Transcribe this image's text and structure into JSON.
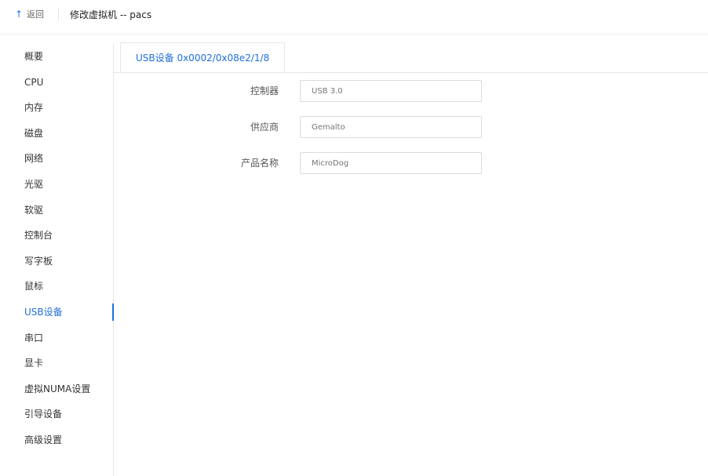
{
  "header": {
    "back_icon": "arrow-up-icon",
    "back_glyph": "↑",
    "back_label": "返回",
    "title": "修改虚拟机 -- pacs"
  },
  "sidebar": {
    "items": [
      {
        "label": "概要"
      },
      {
        "label": "CPU"
      },
      {
        "label": "内存"
      },
      {
        "label": "磁盘"
      },
      {
        "label": "网络"
      },
      {
        "label": "光驱"
      },
      {
        "label": "软驱"
      },
      {
        "label": "控制台"
      },
      {
        "label": "写字板"
      },
      {
        "label": "鼠标"
      },
      {
        "label": "USB设备"
      },
      {
        "label": "串口"
      },
      {
        "label": "显卡"
      },
      {
        "label": "虚拟NUMA设置"
      },
      {
        "label": "引导设备"
      },
      {
        "label": "高级设置"
      }
    ],
    "active_index": 10
  },
  "tabs": [
    {
      "label": "USB设备 0x0002/0x08e2/1/8"
    }
  ],
  "form": {
    "controller_label": "控制器",
    "controller_placeholder": "USB 3.0",
    "vendor_label": "供应商",
    "vendor_placeholder": "Gemalto",
    "product_label": "产品名称",
    "product_placeholder": "MicroDog"
  },
  "colors": {
    "accent": "#1f6fd6",
    "border": "#e6e6e6",
    "text": "#333333",
    "placeholder": "#b8b8b8"
  }
}
